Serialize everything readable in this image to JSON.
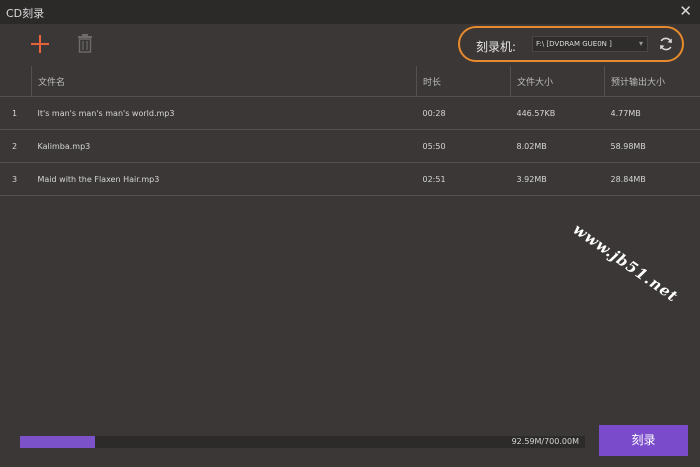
{
  "window": {
    "title": "CD刻录",
    "close_label": "✕"
  },
  "toolbar": {
    "add_icon": "plus-icon",
    "delete_icon": "trash-icon",
    "accent": "#e8623a"
  },
  "burner": {
    "label": "刻录机:",
    "selected": "F:\\ [DVDRAM GUE0N    ]",
    "refresh_icon": "refresh-icon",
    "highlight_color": "#e78a2d"
  },
  "table": {
    "headers": [
      "",
      "文件名",
      "时长",
      "文件大小",
      "预计输出大小"
    ],
    "rows": [
      {
        "index": "1",
        "name": "It's man's man's man's world.mp3",
        "duration": "00:28",
        "size": "446.57KB",
        "output": "4.77MB"
      },
      {
        "index": "2",
        "name": "Kalimba.mp3",
        "duration": "05:50",
        "size": "8.02MB",
        "output": "58.98MB"
      },
      {
        "index": "3",
        "name": "Maid with the Flaxen Hair.mp3",
        "duration": "02:51",
        "size": "3.92MB",
        "output": "28.84MB"
      }
    ]
  },
  "progress": {
    "text": "92.59M/700.00M",
    "fraction": 0.1323,
    "color": "#7b52c7"
  },
  "burn_button": {
    "label": "刻录",
    "color": "#7a4ccc"
  },
  "watermark": {
    "text": "www.jb51.net"
  }
}
